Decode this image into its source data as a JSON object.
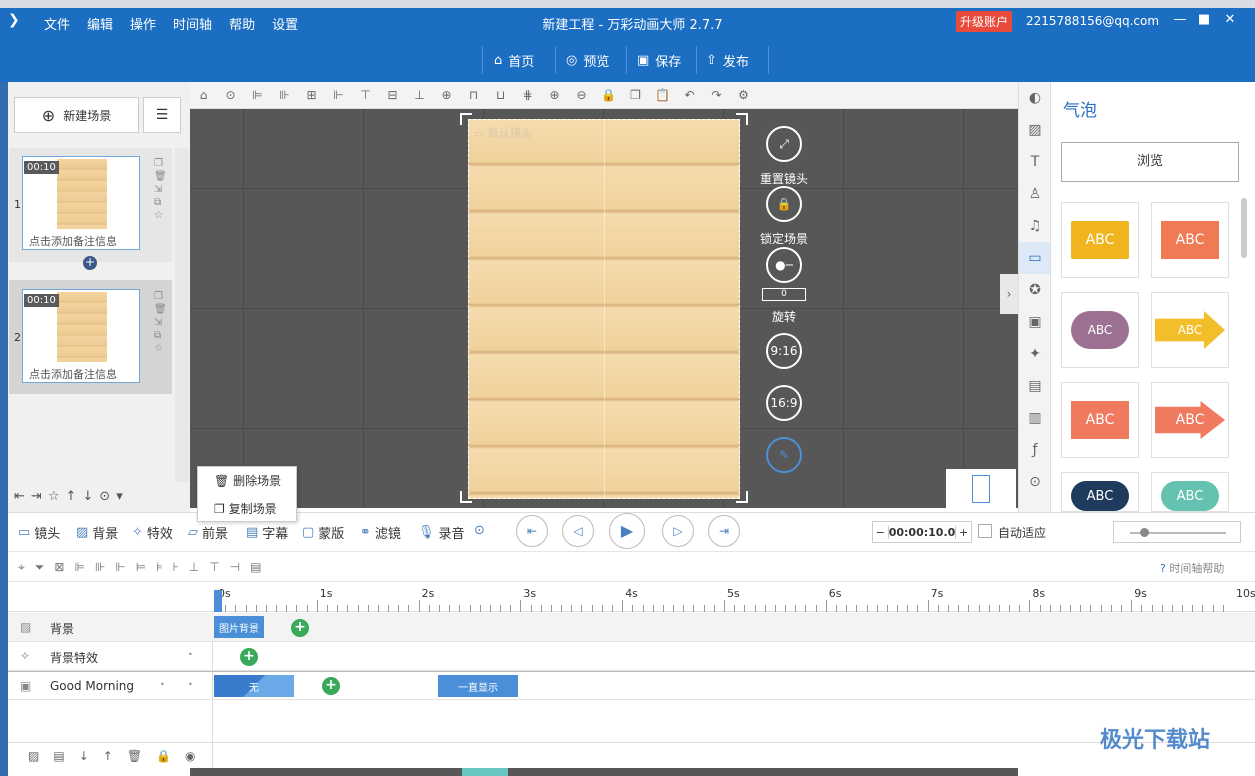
{
  "app": {
    "title": "新建工程 - 万彩动画大师 2.7.7",
    "upgrade_label": "升级账户",
    "account": "2215788156@qq.com"
  },
  "menu": [
    "文件",
    "编辑",
    "操作",
    "时间轴",
    "帮助",
    "设置"
  ],
  "toolbar": {
    "home": "首页",
    "preview": "预览",
    "save": "保存",
    "publish": "发布"
  },
  "scenes_panel": {
    "new_scene_label": "新建场景",
    "scenes": [
      {
        "index": "1",
        "duration": "00:10",
        "note": "点击添加备注信息"
      },
      {
        "index": "2",
        "duration": "00:10",
        "note": "点击添加备注信息"
      }
    ]
  },
  "context_menu": {
    "delete_scene": "删除场景",
    "copy_scene": "复制场景"
  },
  "canvas": {
    "camera_label": "默认镜头",
    "reset_camera": "重置镜头",
    "lock_scene": "锁定场景",
    "rotation_value": "0",
    "rotate_label": "旋转",
    "ratio_916": "9:16",
    "ratio_169": "16:9"
  },
  "right_panel": {
    "title": "气泡",
    "browse": "浏览",
    "bubble_text": "ABC"
  },
  "tabs": {
    "camera": "镜头",
    "background": "背景",
    "effects": "特效",
    "foreground": "前景",
    "subtitle": "字幕",
    "mask": "蒙版",
    "filter": "滤镜",
    "record": "录音"
  },
  "playback": {
    "time_value": "00:00:10.0",
    "auto_fit": "自动适应",
    "timeline_help": "时间轴帮助"
  },
  "timeline": {
    "ticks": [
      "0s",
      "1s",
      "2s",
      "3s",
      "4s",
      "5s",
      "6s",
      "7s",
      "8s",
      "9s",
      "10s"
    ],
    "tracks": [
      {
        "name": "背景"
      },
      {
        "name": "背景特效"
      },
      {
        "name": "Good Morning"
      }
    ],
    "clip_bg": "图片背景",
    "clip_none": "无",
    "clip_always": "一直显示"
  },
  "watermark": "极光下载站"
}
